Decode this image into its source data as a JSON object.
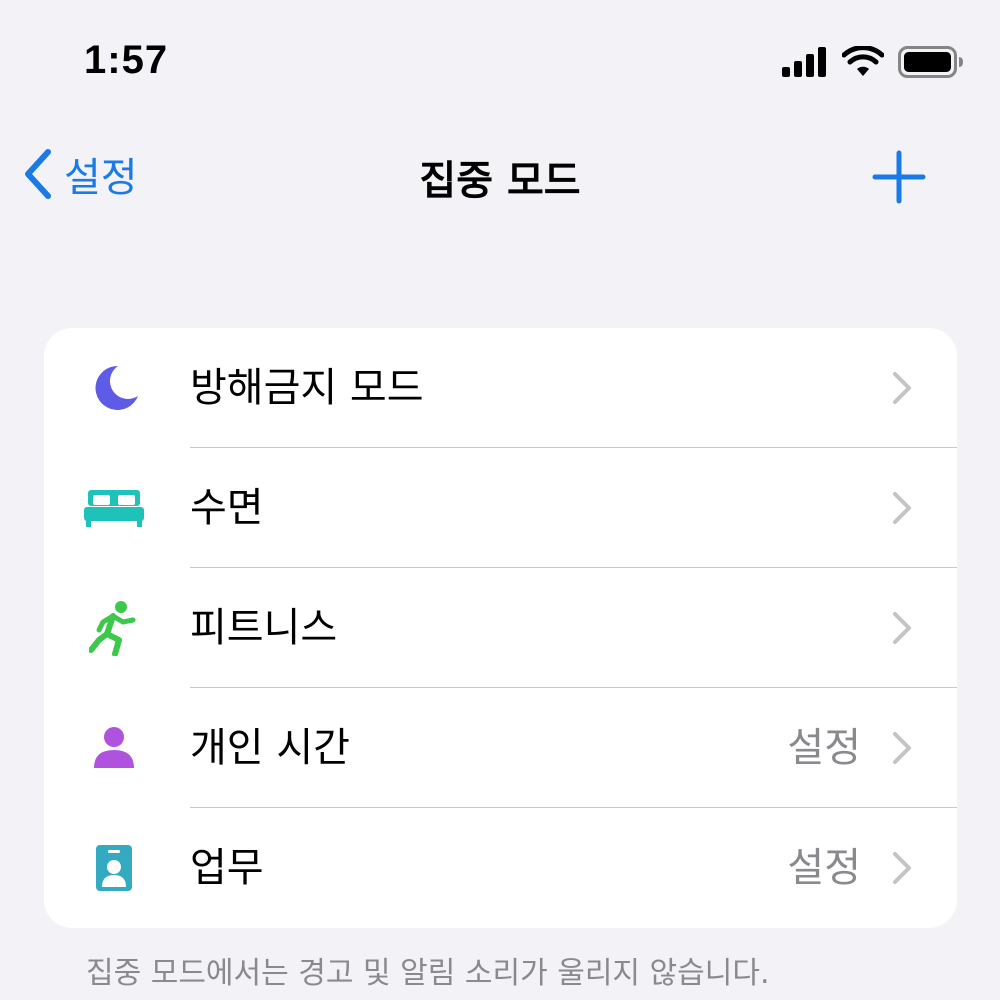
{
  "status_bar": {
    "time": "1:57",
    "icons": [
      "cellular-signal-icon",
      "wifi-icon",
      "battery-icon"
    ]
  },
  "nav": {
    "back_label": "설정",
    "title": "집중 모드",
    "add_icon": "plus-icon"
  },
  "colors": {
    "accent": "#1a7be6",
    "moon": "#5e5ce6",
    "bed": "#1fc2b8",
    "fitness": "#3cc84a",
    "personal": "#af52de",
    "work": "#34aac0",
    "secondary_text": "#8a8a8e"
  },
  "focus_modes": [
    {
      "label": "방해금지 모드",
      "icon": "moon-icon",
      "detail": ""
    },
    {
      "label": "수면",
      "icon": "bed-icon",
      "detail": ""
    },
    {
      "label": "피트니스",
      "icon": "running-person-icon",
      "detail": ""
    },
    {
      "label": "개인 시간",
      "icon": "person-icon",
      "detail": "설정"
    },
    {
      "label": "업무",
      "icon": "id-badge-icon",
      "detail": "설정"
    }
  ],
  "footer": {
    "note": "집중 모드에서는 경고 및 알림 소리가 울리지 않습니다."
  }
}
